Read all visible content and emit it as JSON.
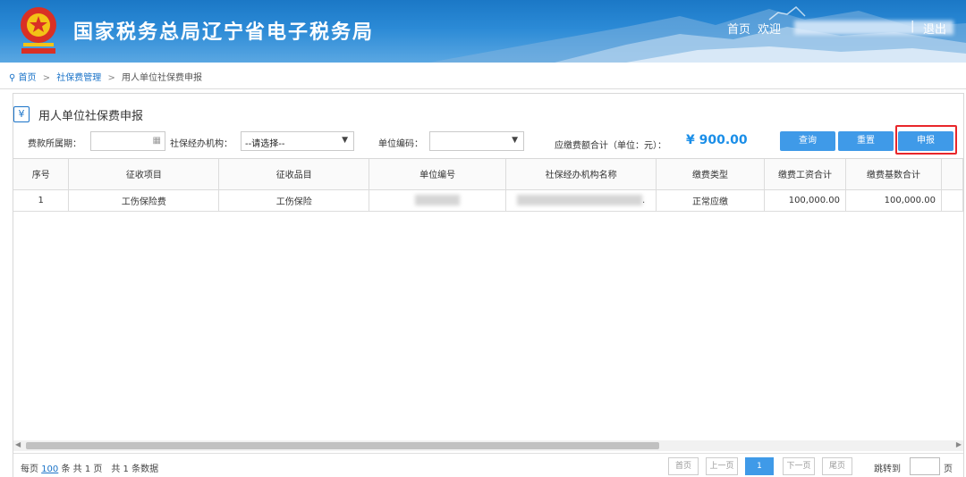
{
  "header": {
    "title": "国家税务总局辽宁省电子税务局",
    "home": "首页",
    "welcome": "欢迎",
    "separator": "|",
    "logout": "退出"
  },
  "breadcrumb": {
    "home": "首页",
    "section": "社保费管理",
    "current": "用人单位社保费申报",
    "arrow": ">"
  },
  "page": {
    "title": "用人单位社保费申报",
    "icon_glyph": "¥"
  },
  "filters": {
    "period_label": "费款所属期：",
    "agency_label": "社保经办机构：",
    "agency_value": "--请选择--",
    "unit_code_label": "单位编码：",
    "unit_code_value": "",
    "total_label": "应缴费额合计（单位：元）：",
    "total_value": "¥ 900.00"
  },
  "buttons": {
    "query": "查询",
    "reset": "重置",
    "declare": "申报"
  },
  "table": {
    "columns": [
      "序号",
      "征收项目",
      "征收品目",
      "单位编号",
      "社保经办机构名称",
      "缴费类型",
      "缴费工资合计",
      "缴费基数合计"
    ],
    "rows": [
      {
        "index": "1",
        "item": "工伤保险费",
        "subitem": "工伤保险",
        "unit_no": "",
        "agency_suffix": ".",
        "pay_type": "正常应缴",
        "wage_total": "100,000.00",
        "base_total": "100,000.00"
      }
    ]
  },
  "pagination": {
    "per_page_prefix": "每页",
    "per_page": "100",
    "per_page_suffix": "条 共 1 页　共 1 条数据",
    "first": "首页",
    "prev": "上一页",
    "current_page": "1",
    "next": "下一页",
    "last": "尾页",
    "goto_label": "跳转到",
    "page_suffix": "页"
  },
  "colors": {
    "accent": "#3f9ae8",
    "highlight": "#e8262a",
    "total_value": "#1a8ee8"
  }
}
